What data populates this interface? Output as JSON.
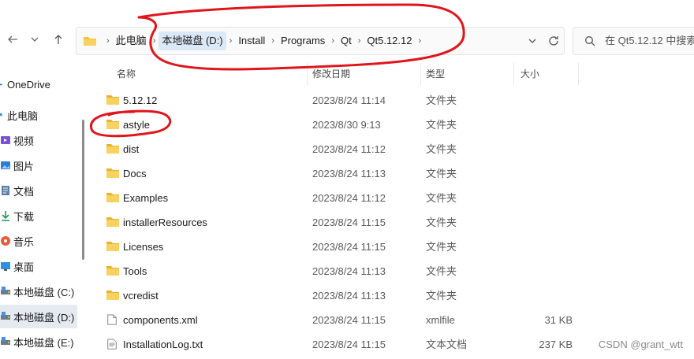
{
  "nav": {
    "back_icon": "arrow-left-icon",
    "forward_icon": "chevron-down-icon",
    "up_icon": "arrow-up-icon"
  },
  "breadcrumb": {
    "items": [
      "此电脑",
      "本地磁盘 (D:)",
      "Install",
      "Programs",
      "Qt",
      "Qt5.12.12"
    ],
    "dropdown_icon": "chevron-down-icon",
    "refresh_icon": "refresh-icon"
  },
  "search": {
    "placeholder": "在 Qt5.12.12 中搜索"
  },
  "sidebar": {
    "items": [
      {
        "label": "OneDrive",
        "icon": "cloud-icon"
      },
      {
        "label": "此电脑",
        "icon": "computer-icon"
      },
      {
        "label": "视频",
        "icon": "video-icon"
      },
      {
        "label": "图片",
        "icon": "picture-icon"
      },
      {
        "label": "文档",
        "icon": "document-icon"
      },
      {
        "label": "下载",
        "icon": "download-icon"
      },
      {
        "label": "音乐",
        "icon": "music-icon"
      },
      {
        "label": "桌面",
        "icon": "desktop-icon"
      },
      {
        "label": "本地磁盘 (C:)",
        "icon": "drive-icon"
      },
      {
        "label": "本地磁盘 (D:)",
        "icon": "drive-icon"
      },
      {
        "label": "本地磁盘 (E:)",
        "icon": "drive-icon"
      }
    ]
  },
  "columns": {
    "name": "名称",
    "date": "修改日期",
    "type": "类型",
    "size": "大小"
  },
  "files": [
    {
      "name": "5.12.12",
      "date": "2023/8/24 11:14",
      "type": "文件夹",
      "size": "",
      "icon": "folder-icon"
    },
    {
      "name": "astyle",
      "date": "2023/8/30 9:13",
      "type": "文件夹",
      "size": "",
      "icon": "folder-icon"
    },
    {
      "name": "dist",
      "date": "2023/8/24 11:12",
      "type": "文件夹",
      "size": "",
      "icon": "folder-icon"
    },
    {
      "name": "Docs",
      "date": "2023/8/24 11:13",
      "type": "文件夹",
      "size": "",
      "icon": "folder-icon"
    },
    {
      "name": "Examples",
      "date": "2023/8/24 11:12",
      "type": "文件夹",
      "size": "",
      "icon": "folder-icon"
    },
    {
      "name": "installerResources",
      "date": "2023/8/24 11:15",
      "type": "文件夹",
      "size": "",
      "icon": "folder-icon"
    },
    {
      "name": "Licenses",
      "date": "2023/8/24 11:15",
      "type": "文件夹",
      "size": "",
      "icon": "folder-icon"
    },
    {
      "name": "Tools",
      "date": "2023/8/24 11:13",
      "type": "文件夹",
      "size": "",
      "icon": "folder-icon"
    },
    {
      "name": "vcredist",
      "date": "2023/8/24 11:13",
      "type": "文件夹",
      "size": "",
      "icon": "folder-icon"
    },
    {
      "name": "components.xml",
      "date": "2023/8/24 11:15",
      "type": "xmlfile",
      "size": "31 KB",
      "icon": "file-icon"
    },
    {
      "name": "InstallationLog.txt",
      "date": "2023/8/24 11:15",
      "type": "文本文档",
      "size": "237 KB",
      "icon": "text-file-icon"
    }
  ],
  "watermark": "CSDN @grant_wtt",
  "colors": {
    "folder": "#f4c23d",
    "selection": "#dbe9f7",
    "annotation": "#e0151c"
  }
}
